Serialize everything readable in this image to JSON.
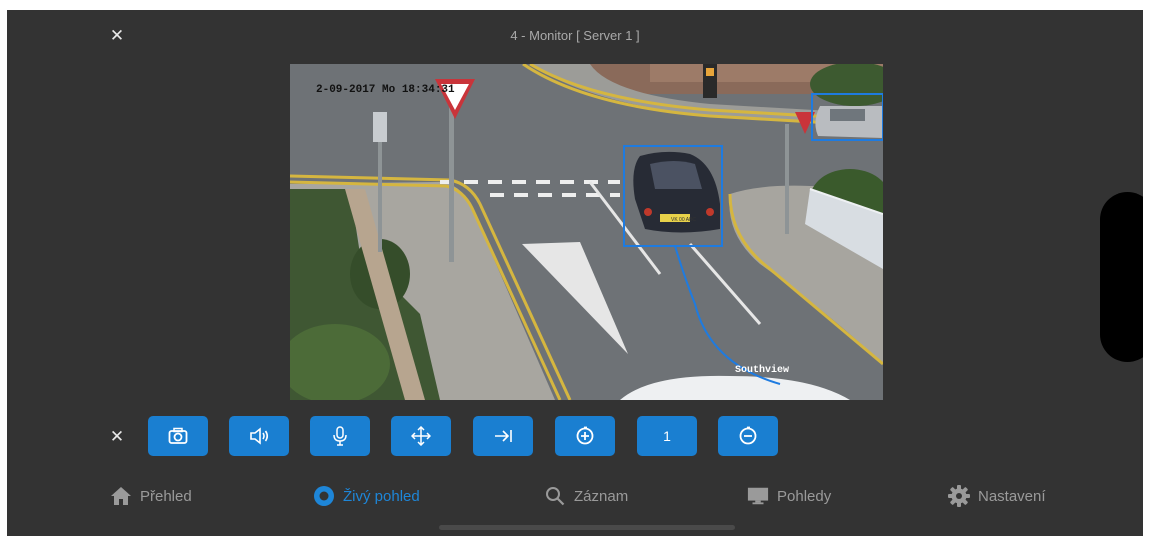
{
  "window": {
    "title": "4 - Monitor [ Server 1 ]"
  },
  "video": {
    "timestamp": "2-09-2017 Mo  18:34:31",
    "caption": "Southview",
    "plate_text": "VK 00 ABC",
    "detection_color": "#1e7be0"
  },
  "toolbar": {
    "buttons": [
      {
        "icon": "camera-icon"
      },
      {
        "icon": "speaker-icon"
      },
      {
        "icon": "microphone-icon"
      },
      {
        "icon": "move-arrows-icon"
      },
      {
        "icon": "arrow-to-end-icon"
      },
      {
        "icon": "zoom-in-icon"
      },
      {
        "icon": "preset-number",
        "label": "1"
      },
      {
        "icon": "zoom-out-icon"
      }
    ],
    "accent": "#1a7fd1"
  },
  "bottom_nav": {
    "items": [
      {
        "label": "Přehled",
        "icon": "home-icon"
      },
      {
        "label": "Živý pohled",
        "icon": "live-icon",
        "active": true
      },
      {
        "label": "Záznam",
        "icon": "search-icon"
      },
      {
        "label": "Pohledy",
        "icon": "monitor-icon"
      },
      {
        "label": "Nastavení",
        "icon": "gear-icon"
      }
    ],
    "active_color": "#1e86d8",
    "inactive_color": "#9a9a9a"
  }
}
